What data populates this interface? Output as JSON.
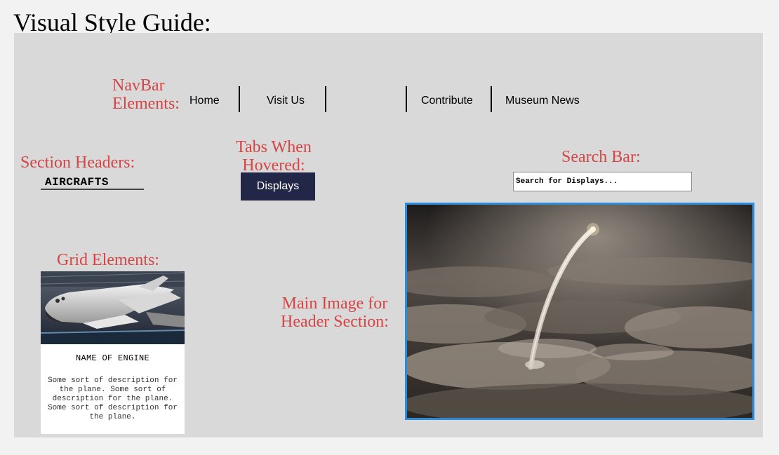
{
  "page": {
    "title": "Visual Style Guide:"
  },
  "labels": {
    "navbar_line1": "NavBar",
    "navbar_line2": "Elements:",
    "section_headers": "Section Headers:",
    "tabs_line1": "Tabs When",
    "tabs_line2": "Hovered:",
    "search_bar": "Search Bar:",
    "grid_elements": "Grid Elements:",
    "main_image_line1": "Main Image for",
    "main_image_line2": "Header Section:"
  },
  "navbar": {
    "items": [
      {
        "label": "Home"
      },
      {
        "label": "Visit Us"
      },
      {
        "label": ""
      },
      {
        "label": "Contribute"
      },
      {
        "label": "Museum News"
      }
    ]
  },
  "section_header": {
    "text": "AIRCRAFTS"
  },
  "tab": {
    "label": "Displays",
    "color": "#232747"
  },
  "search": {
    "placeholder": "Search for Displays..."
  },
  "grid_card": {
    "title": "NAME OF ENGINE",
    "description": "Some sort of description for the plane. Some sort of description for the plane. Some sort of description for the plane."
  },
  "colors": {
    "label_red": "#d64545",
    "panel_gray": "#d9d9d9",
    "image_border": "#2e8bd9"
  }
}
